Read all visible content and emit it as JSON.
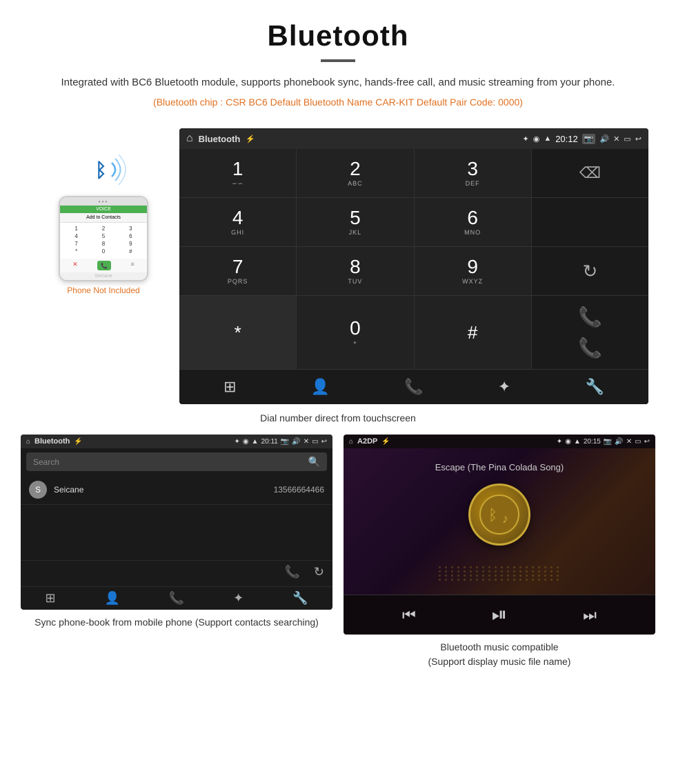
{
  "header": {
    "title": "Bluetooth",
    "description": "Integrated with BC6 Bluetooth module, supports phonebook sync, hands-free call, and music streaming from your phone.",
    "specs": "(Bluetooth chip : CSR BC6    Default Bluetooth Name CAR-KIT    Default Pair Code: 0000)"
  },
  "phone": {
    "not_included": "Phone Not Included",
    "watermark": "Seicane"
  },
  "dial_screen": {
    "app_label": "Bluetooth",
    "time": "20:12",
    "keys": [
      {
        "num": "1",
        "sub": "∽∽"
      },
      {
        "num": "2",
        "sub": "ABC"
      },
      {
        "num": "3",
        "sub": "DEF"
      },
      {
        "num": "4",
        "sub": "GHI"
      },
      {
        "num": "5",
        "sub": "JKL"
      },
      {
        "num": "6",
        "sub": "MNO"
      },
      {
        "num": "7",
        "sub": "PQRS"
      },
      {
        "num": "8",
        "sub": "TUV"
      },
      {
        "num": "9",
        "sub": "WXYZ"
      },
      {
        "num": "*",
        "sub": ""
      },
      {
        "num": "0",
        "sub": "+"
      },
      {
        "num": "#",
        "sub": ""
      }
    ],
    "caption": "Dial number direct from touchscreen"
  },
  "phonebook_screen": {
    "app_label": "Bluetooth",
    "time": "20:11",
    "search_placeholder": "Search",
    "contact_name": "Seicane",
    "contact_phone": "13566664466",
    "contact_initial": "S"
  },
  "music_screen": {
    "app_label": "A2DP",
    "time": "20:15",
    "song_title": "Escape (The Pina Colada Song)"
  },
  "captions": {
    "phonebook": "Sync phone-book from mobile phone\n(Support contacts searching)",
    "music": "Bluetooth music compatible\n(Support display music file name)"
  },
  "icons": {
    "home": "⌂",
    "usb": "⚡",
    "bluetooth": "✦",
    "location": "◉",
    "wifi": "▲",
    "camera": "📷",
    "volume": "🔊",
    "close_app": "✕",
    "multi_window": "▭",
    "back": "↩",
    "delete": "⌫",
    "call_green": "📞",
    "call_red": "📞",
    "refresh": "↻",
    "dialpad": "⊞",
    "person": "👤",
    "phone": "📞",
    "bt": "✦",
    "wrench": "🔧",
    "search": "🔍",
    "skip_back": "⏮",
    "play_pause": "⏯",
    "skip_fwd": "⏭"
  }
}
